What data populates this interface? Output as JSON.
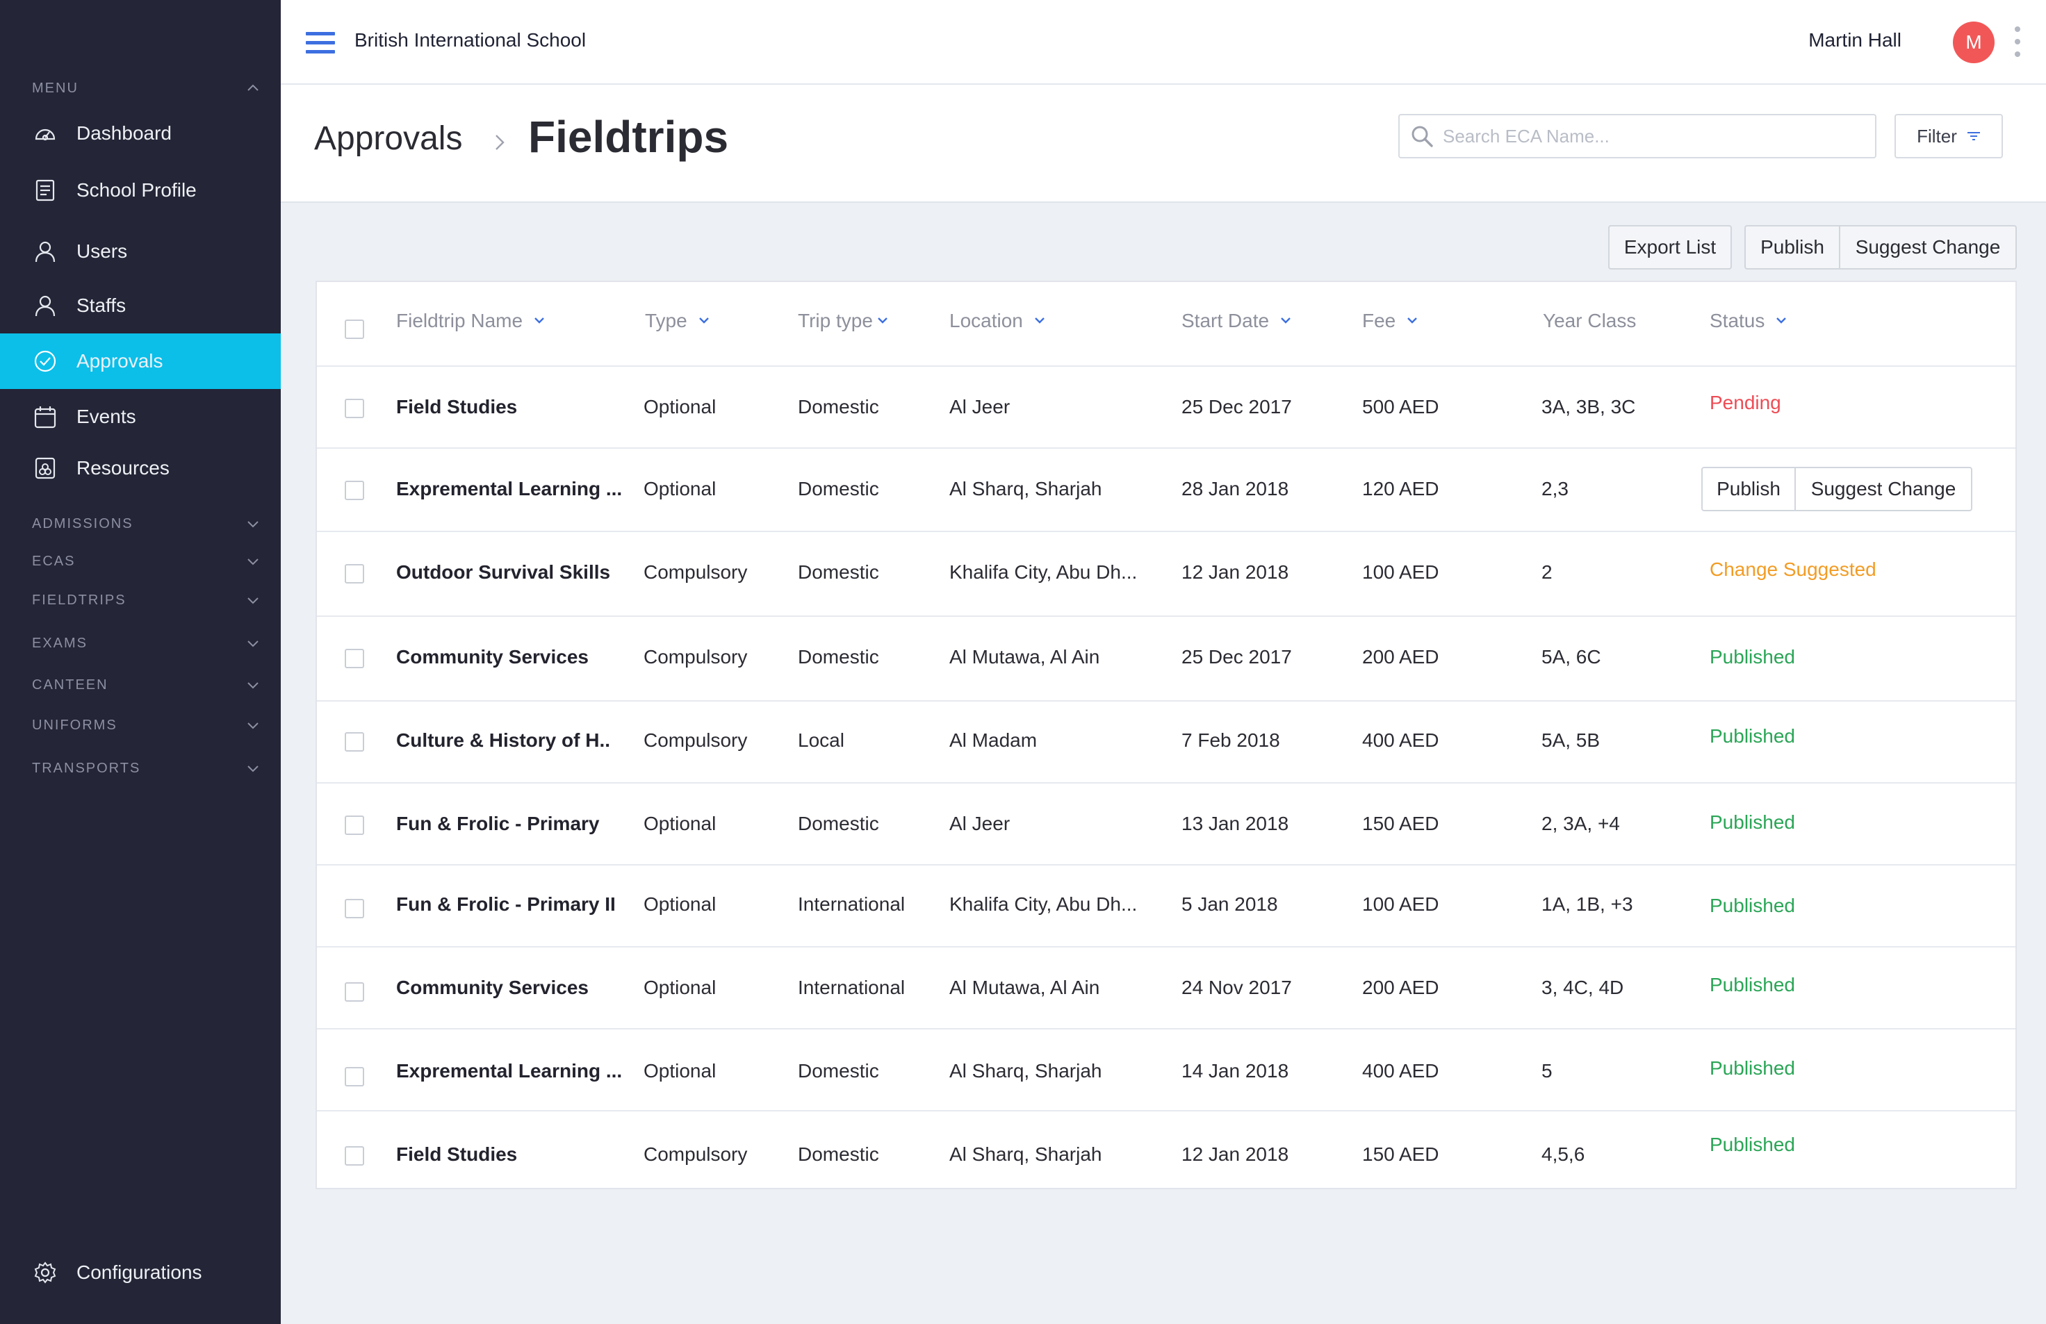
{
  "sidebar": {
    "menu_label": "MENU",
    "items": [
      {
        "label": "Dashboard",
        "icon": "dashboard-icon"
      },
      {
        "label": "School Profile",
        "icon": "document-icon"
      },
      {
        "label": "Users",
        "icon": "user-icon"
      },
      {
        "label": "Staffs",
        "icon": "user-icon"
      },
      {
        "label": "Approvals",
        "icon": "check-circle-icon",
        "active": true
      },
      {
        "label": "Events",
        "icon": "calendar-icon"
      },
      {
        "label": "Resources",
        "icon": "resources-icon"
      }
    ],
    "sections": [
      "ADMISSIONS",
      "ECAS",
      "FIELDTRIPS",
      "EXAMS",
      "CANTEEN",
      "UNIFORMS",
      "TRANSPORTS"
    ],
    "config_label": "Configurations"
  },
  "topbar": {
    "school_name": "British International School",
    "user_name": "Martin Hall",
    "avatar_initial": "M"
  },
  "header": {
    "breadcrumb_parent": "Approvals",
    "page_title": "Fieldtrips",
    "search_placeholder": "Search ECA Name...",
    "filter_label": "Filter"
  },
  "actions": {
    "export_label": "Export List",
    "publish_label": "Publish",
    "suggest_label": "Suggest Change"
  },
  "table": {
    "columns": [
      "Fieldtrip Name",
      "Type",
      "Trip type",
      "Location",
      "Start Date",
      "Fee",
      "Year Class",
      "Status"
    ],
    "rows": [
      {
        "name": "Field Studies",
        "type": "Optional",
        "trip_type": "Domestic",
        "location": "Al Jeer",
        "start_date": "25 Dec 2017",
        "fee": "500 AED",
        "year_class": "3A, 3B, 3C",
        "status": "Pending",
        "status_kind": "pending"
      },
      {
        "name": "Expremental Learning ...",
        "type": "Optional",
        "trip_type": "Domestic",
        "location": "Al Sharq, Sharjah",
        "start_date": "28 Jan 2018",
        "fee": "120 AED",
        "year_class": "2,3",
        "status": "",
        "status_kind": "actions",
        "publish_label": "Publish",
        "suggest_label": "Suggest Change"
      },
      {
        "name": "Outdoor Survival Skills",
        "type": "Compulsory",
        "trip_type": "Domestic",
        "location": "Khalifa City, Abu Dh...",
        "start_date": "12 Jan 2018",
        "fee": "100 AED",
        "year_class": "2",
        "status": "Change Suggested",
        "status_kind": "change"
      },
      {
        "name": "Community Services",
        "type": "Compulsory",
        "trip_type": "Domestic",
        "location": "Al Mutawa, Al Ain",
        "start_date": "25 Dec 2017",
        "fee": "200 AED",
        "year_class": "5A, 6C",
        "status": "Published",
        "status_kind": "published"
      },
      {
        "name": "Culture & History of H..",
        "type": "Compulsory",
        "trip_type": "Local",
        "location": "Al Madam",
        "start_date": "7 Feb 2018",
        "fee": "400 AED",
        "year_class": "5A, 5B",
        "status": "Published",
        "status_kind": "published"
      },
      {
        "name": "Fun & Frolic - Primary",
        "type": "Optional",
        "trip_type": "Domestic",
        "location": "Al Jeer",
        "start_date": "13 Jan 2018",
        "fee": "150 AED",
        "year_class": "2, 3A, +4",
        "status": "Published",
        "status_kind": "published"
      },
      {
        "name": "Fun & Frolic - Primary II",
        "type": "Optional",
        "trip_type": "International",
        "location": "Khalifa City, Abu Dh...",
        "start_date": "5 Jan 2018",
        "fee": "100 AED",
        "year_class": "1A, 1B, +3",
        "status": "Published",
        "status_kind": "published"
      },
      {
        "name": "Community Services",
        "type": "Optional",
        "trip_type": "International",
        "location": "Al Mutawa, Al Ain",
        "start_date": "24 Nov 2017",
        "fee": "200 AED",
        "year_class": "3, 4C, 4D",
        "status": "Published",
        "status_kind": "published"
      },
      {
        "name": "Expremental Learning ...",
        "type": "Optional",
        "trip_type": "Domestic",
        "location": "Al Sharq, Sharjah",
        "start_date": "14 Jan 2018",
        "fee": "400 AED",
        "year_class": "5",
        "status": "Published",
        "status_kind": "published"
      },
      {
        "name": "Field Studies",
        "type": "Compulsory",
        "trip_type": "Domestic",
        "location": "Al Sharq, Sharjah",
        "start_date": "12 Jan 2018",
        "fee": "150 AED",
        "year_class": "4,5,6",
        "status": "Published",
        "status_kind": "published"
      }
    ]
  },
  "colors": {
    "sidebar_bg": "#242536",
    "active": "#0bbfe9",
    "pending": "#ee4c55",
    "change_suggested": "#f29c24",
    "published": "#2aa556",
    "avatar": "#f25757",
    "accent": "#3d6fe0"
  }
}
